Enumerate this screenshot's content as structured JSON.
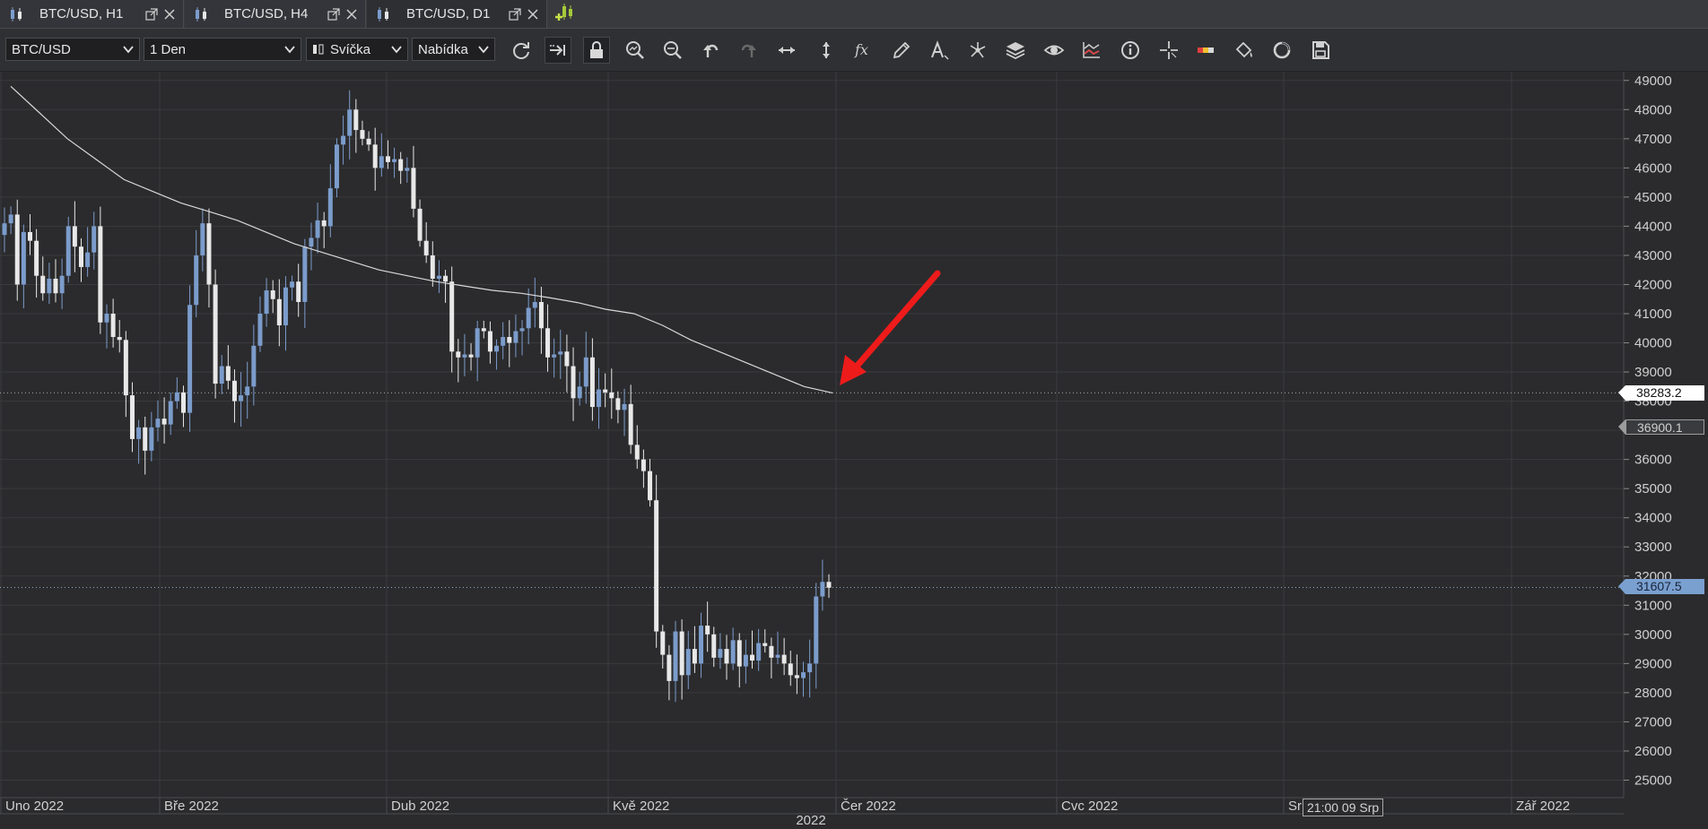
{
  "tabs": [
    {
      "label": "BTC/USD, H1",
      "active": false
    },
    {
      "label": "BTC/USD, H4",
      "active": false
    },
    {
      "label": "BTC/USD, D1",
      "active": true
    }
  ],
  "toolbar": {
    "symbol": "BTC/USD",
    "timeframe": "1 Den",
    "chart_type": "Svíčka",
    "price_side": "Nabídka",
    "buttons": [
      "refresh-icon",
      "autoscroll-icon",
      "lock-icon",
      "zoom-in-icon",
      "zoom-out-icon",
      "undo-icon",
      "redo-icon",
      "horizontal-scale-icon",
      "vertical-scale-icon",
      "indicators-fx-icon",
      "pencil-icon",
      "text-tool-icon",
      "drawing-tools-icon",
      "layers-icon",
      "eye-icon",
      "chart-compare-icon",
      "info-icon",
      "crosshair-icon",
      "color-scheme-icon",
      "paint-bucket-icon",
      "reset-icon",
      "save-icon"
    ]
  },
  "colors": {
    "background": "#2b2b2d",
    "bull": "#7b9ccb",
    "bear": "#e8e8e8",
    "ma": "#d8d8d8",
    "arrow": "#ee1b1b",
    "grid": "#3a3b3e"
  },
  "chart_data": {
    "type": "candlestick",
    "symbol": "BTC/USD",
    "timeframe": "D1",
    "y_ticks": [
      49000,
      48000,
      47000,
      46000,
      45000,
      44000,
      43000,
      42000,
      41000,
      40000,
      39000,
      38000,
      37000,
      36000,
      35000,
      34000,
      33000,
      32000,
      31000,
      30000,
      29000,
      28000,
      27000,
      26000,
      25000
    ],
    "x_labels": [
      "Uno 2022",
      "Bře 2022",
      "Dub 2022",
      "Kvě 2022",
      "Čer 2022",
      "Cvc 2022",
      "Srp",
      "Zář 2022"
    ],
    "year_label": "2022",
    "ylim": [
      24400,
      49300
    ],
    "price_lines": [
      {
        "label": "38283.2",
        "value": 38283.2,
        "style": "white"
      },
      {
        "label": "36900.1",
        "value": 36900.1,
        "style": "gray"
      },
      {
        "label": "31607.5",
        "value": 31607.5,
        "style": "blue"
      }
    ],
    "crosshair_time": "21:00 09 Srp",
    "candles_close": [
      44100,
      44400,
      42000,
      43800,
      43500,
      42300,
      41700,
      42200,
      41700,
      42300,
      44000,
      43300,
      42600,
      43100,
      44000,
      40700,
      41000,
      40200,
      40100,
      38200,
      36700,
      37100,
      36300,
      37100,
      37400,
      37200,
      38000,
      38300,
      37600,
      41300,
      43000,
      44100,
      42000,
      38600,
      39200,
      38700,
      38000,
      38200,
      38500,
      39900,
      41000,
      41800,
      41500,
      40600,
      41900,
      42100,
      41400,
      43300,
      43600,
      44200,
      44000,
      45300,
      46800,
      47100,
      48000,
      47300,
      47000,
      46800,
      46000,
      46400,
      46200,
      46300,
      45900,
      46000,
      44600,
      43500,
      43000,
      42200,
      42300,
      42100,
      39700,
      39500,
      39600,
      39500,
      40500,
      40400,
      39700,
      39900,
      40200,
      40000,
      40400,
      40500,
      41200,
      41400,
      40500,
      39500,
      39600,
      39700,
      39200,
      38100,
      38500,
      39500,
      37800,
      38400,
      38300,
      38100,
      37700,
      37900,
      36500,
      36000,
      35600,
      34600,
      30100,
      29300,
      28400,
      30100,
      28600,
      29500,
      29000,
      30300,
      30000,
      29200,
      29500,
      29000,
      29800,
      28900,
      29300,
      29100,
      29700,
      29600,
      29200,
      29300,
      29000,
      28600,
      28500,
      28700,
      29000,
      31300,
      31800,
      31600
    ]
  },
  "ma_line": {
    "name": "",
    "values": [
      48800,
      47900,
      47000,
      46300,
      45600,
      45200,
      44800,
      44500,
      44200,
      43800,
      43400,
      43100,
      42800,
      42500,
      42300,
      42100,
      41950,
      41800,
      41700,
      41550,
      41380,
      41150,
      41000,
      40600,
      40100,
      39700,
      39300,
      38900,
      38500,
      38283.2
    ]
  },
  "time_axis": {
    "labels": [
      "Uno 2022",
      "Bře 2022",
      "Dub 2022",
      "Kvě 2022",
      "Čer 2022",
      "Cvc 2022",
      "Srp",
      "Zář 2022"
    ]
  }
}
